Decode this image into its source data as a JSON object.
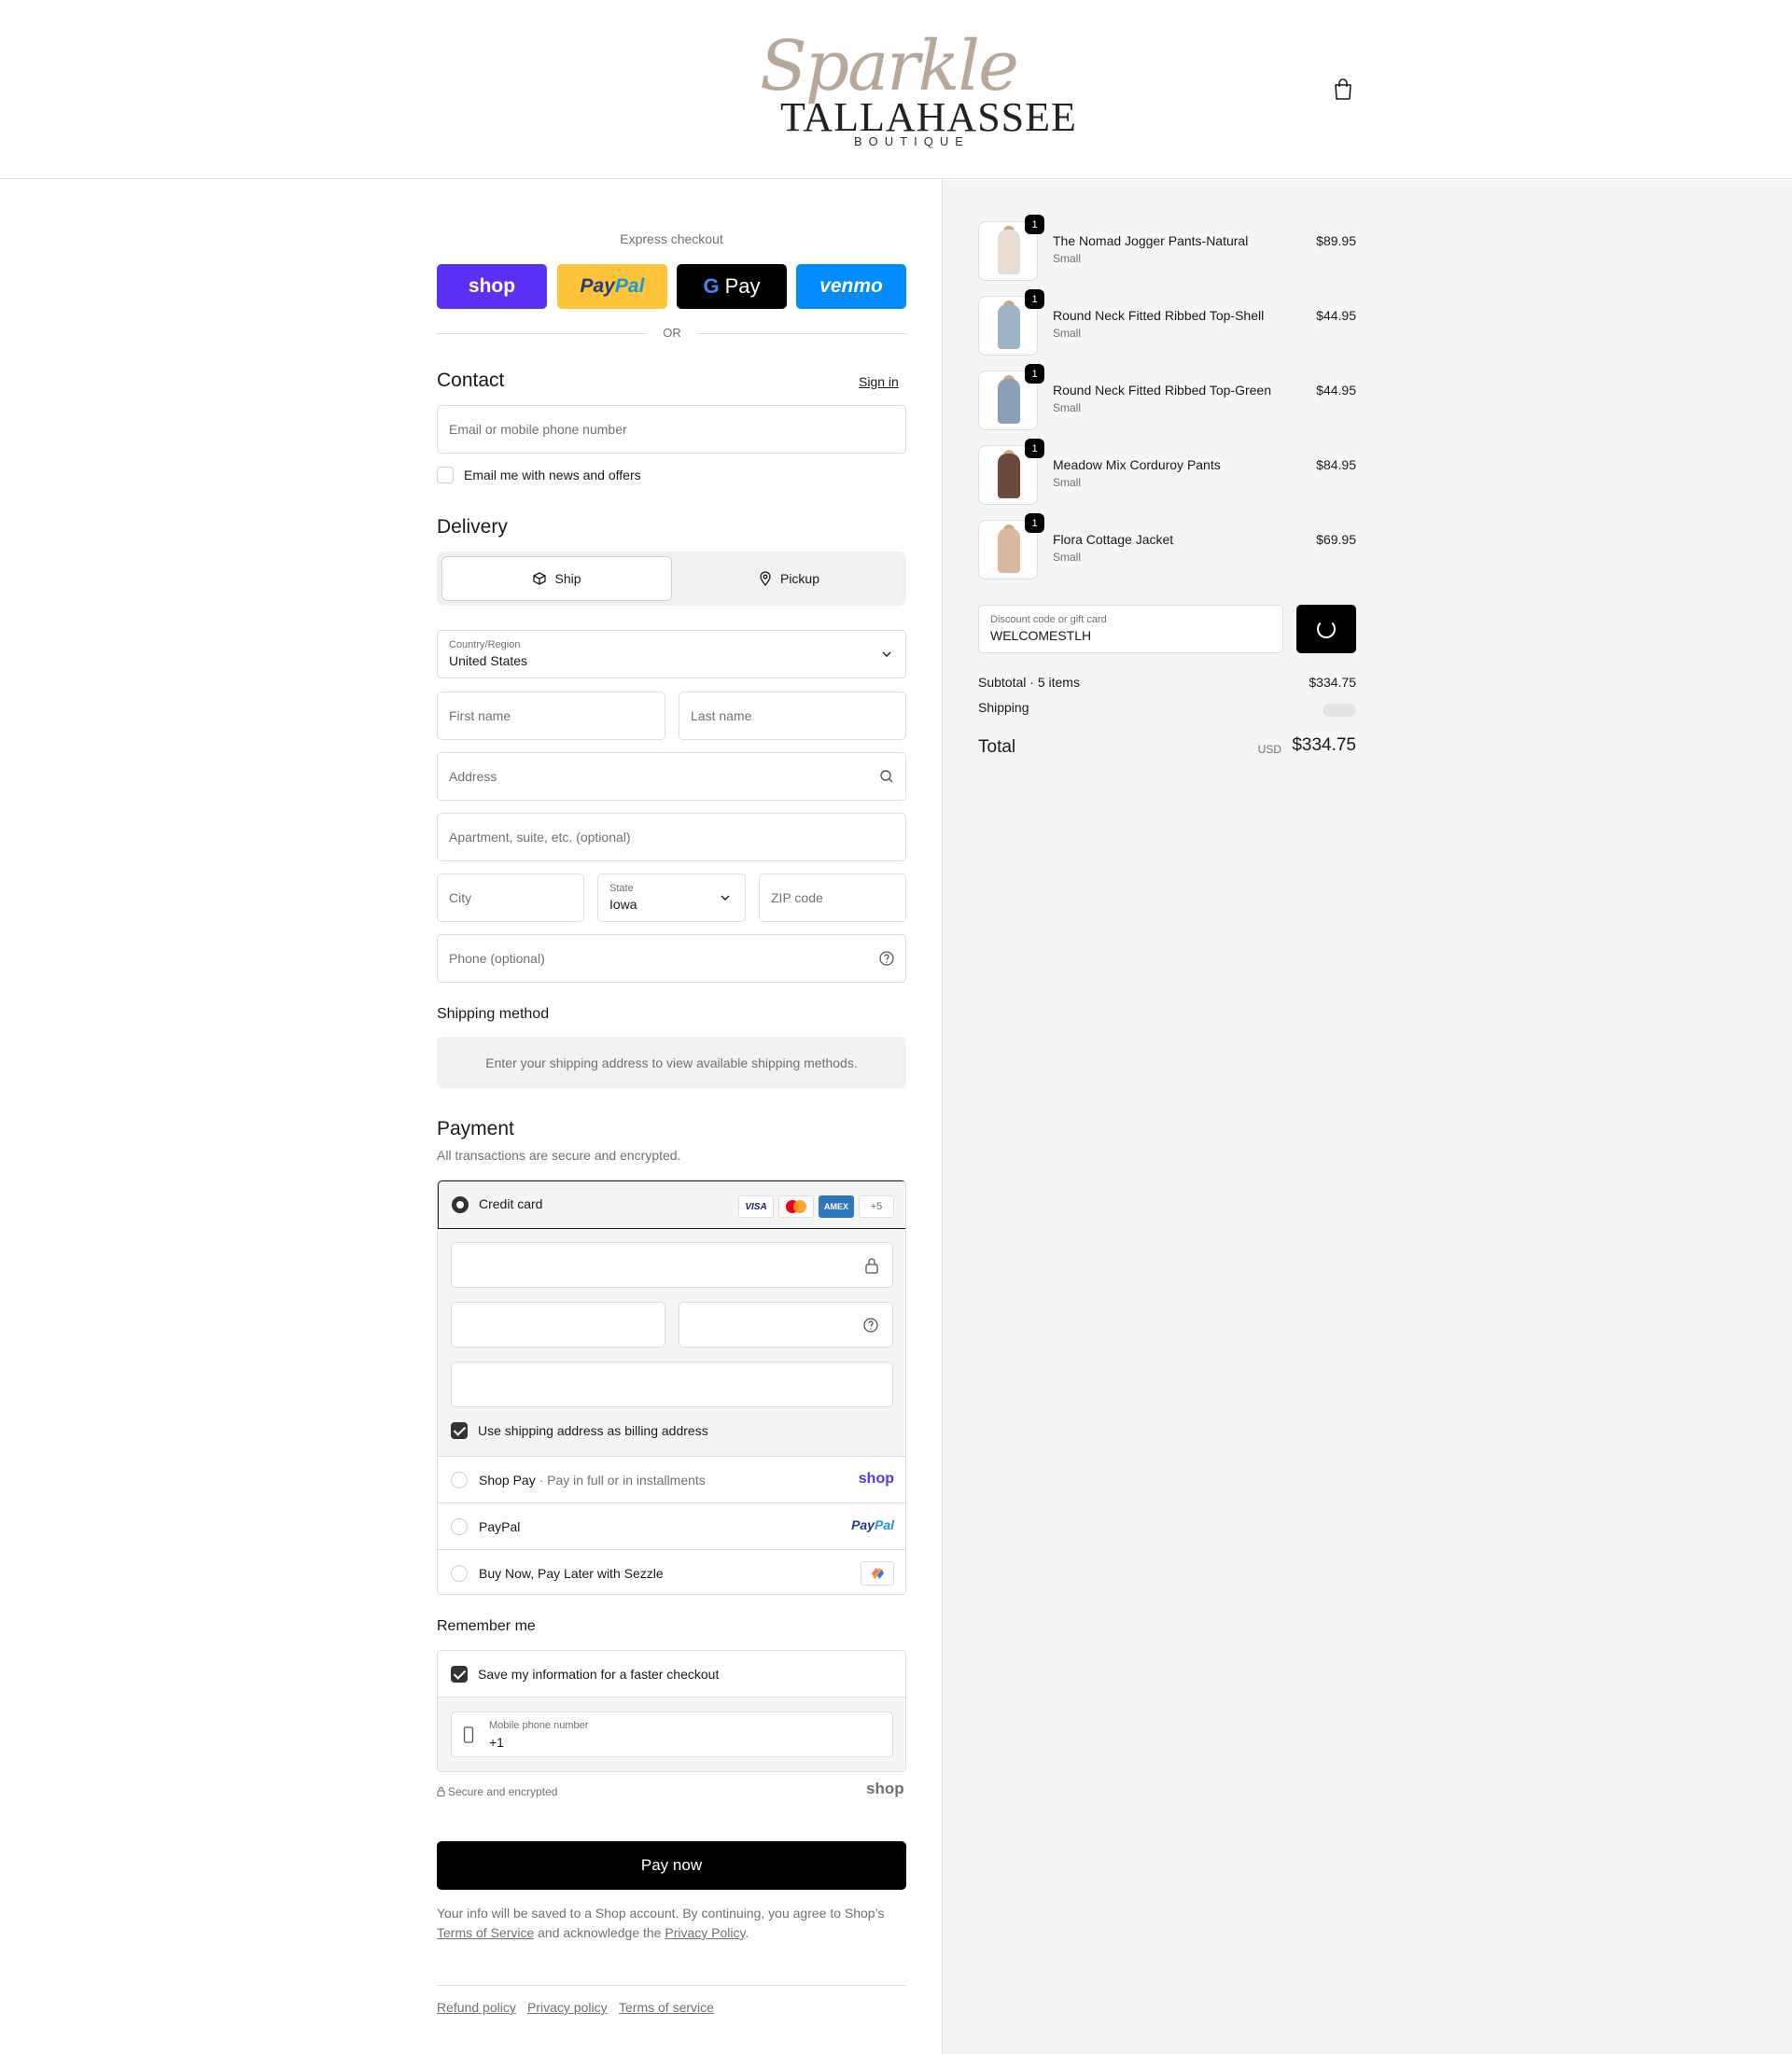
{
  "header": {
    "logo_script": "Sparkle",
    "logo_brand": "TALLAHASSEE",
    "logo_sub": "BOUTIQUE"
  },
  "express": {
    "label": "Express checkout",
    "shop": "shop",
    "paypal_a": "Pay",
    "paypal_b": "Pal",
    "gpay_g": "G",
    "gpay": "Pay",
    "venmo": "venmo",
    "or": "OR"
  },
  "contact": {
    "title": "Contact",
    "sign_in": "Sign in",
    "email_placeholder": "Email or mobile phone number",
    "news_label": "Email me with news and offers"
  },
  "delivery": {
    "title": "Delivery",
    "ship": "Ship",
    "pickup": "Pickup",
    "country_label": "Country/Region",
    "country_value": "United States",
    "first_name": "First name",
    "last_name": "Last name",
    "address": "Address",
    "apartment": "Apartment, suite, etc. (optional)",
    "city": "City",
    "state_label": "State",
    "state_value": "Iowa",
    "zip": "ZIP code",
    "phone": "Phone (optional)"
  },
  "shipping": {
    "title": "Shipping method",
    "note": "Enter your shipping address to view available shipping methods."
  },
  "payment": {
    "title": "Payment",
    "subtitle": "All transactions are secure and encrypted.",
    "credit_card": "Credit card",
    "visa": "VISA",
    "amex": "AMEX",
    "more": "+5",
    "billing_label": "Use shipping address as billing address",
    "shop_pay": "Shop Pay",
    "shop_pay_sep": "·",
    "shop_pay_sub": "Pay in full or in installments",
    "shop_pay_logo": "shop",
    "paypal": "PayPal",
    "paypal_logo_a": "Pay",
    "paypal_logo_b": "Pal",
    "sezzle": "Buy Now, Pay Later with Sezzle"
  },
  "remember": {
    "title": "Remember me",
    "save_label": "Save my information for a faster checkout",
    "phone_label": "Mobile phone number",
    "phone_value": "+1",
    "secure": "Secure and encrypted",
    "shop_mark": "shop"
  },
  "pay_now": "Pay now",
  "legal": {
    "text1": "Your info will be saved to a Shop account. By continuing, you agree to Shop’s",
    "terms": "Terms of Service",
    "text2": "and acknowledge the",
    "privacy": "Privacy Policy",
    "text3": "."
  },
  "footer": {
    "refund": "Refund policy",
    "privacy": "Privacy policy",
    "terms": "Terms of service"
  },
  "order": {
    "items": [
      {
        "name": "The Nomad Jogger Pants-Natural",
        "variant": "Small",
        "price": "$89.95",
        "qty": "1",
        "color": "#e8ddd0"
      },
      {
        "name": "Round Neck Fitted Ribbed Top-Shell",
        "variant": "Small",
        "price": "$44.95",
        "qty": "1",
        "color": "#9fb2c8"
      },
      {
        "name": "Round Neck Fitted Ribbed Top-Green",
        "variant": "Small",
        "price": "$44.95",
        "qty": "1",
        "color": "#8aa0b8"
      },
      {
        "name": "Meadow Mix Corduroy Pants",
        "variant": "Small",
        "price": "$84.95",
        "qty": "1",
        "color": "#6b4a3a"
      },
      {
        "name": "Flora Cottage Jacket",
        "variant": "Small",
        "price": "$69.95",
        "qty": "1",
        "color": "#d9b8a0"
      }
    ],
    "discount_label": "Discount code or gift card",
    "discount_value": "WELCOMESTLH",
    "subtotal_label": "Subtotal · 5 items",
    "subtotal_value": "$334.75",
    "shipping_label": "Shipping",
    "total_label": "Total",
    "currency": "USD",
    "total_value": "$334.75"
  },
  "colors": {
    "shop_purple": "#5a31f4",
    "paypal_yellow": "#ffc439",
    "venmo_blue": "#008cff",
    "primary_black": "#000000"
  }
}
